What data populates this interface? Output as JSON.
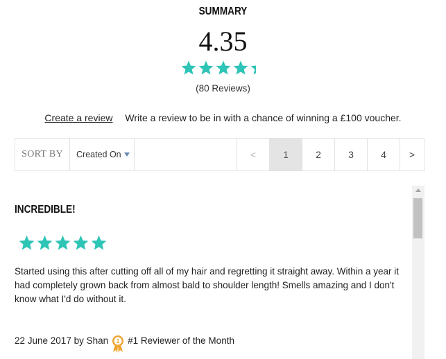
{
  "summary": {
    "title": "SUMMARY",
    "rating": "4.35",
    "rating_fraction": 0.87,
    "review_count": "(80 Reviews)"
  },
  "promo": {
    "link_text": "Create a review",
    "message": "Write a review to be in with a chance of winning a £100 voucher."
  },
  "toolbar": {
    "sort_label": "SORT BY",
    "sort_value": "Created On",
    "prev": "<",
    "pages": [
      "1",
      "2",
      "3",
      "4"
    ],
    "active_page": "1",
    "next": ">"
  },
  "review": {
    "title": "INCREDIBLE!",
    "stars": 5,
    "body": "Started using this after cutting off all of my hair and regretting it straight away. Within a year it had completely grown back from almost bald to shoulder length! Smells amazing and I don't know what I'd do without it.",
    "date_author": "22 June 2017 by Shan",
    "badge_text": "#1 Reviewer of the Month",
    "badge_number": "1"
  },
  "colors": {
    "star": "#2ec4b6",
    "star_empty": "#d9d9d9",
    "badge": "#f0a431"
  },
  "icons": {
    "star": "star-icon",
    "badge": "award-ribbon-icon"
  }
}
